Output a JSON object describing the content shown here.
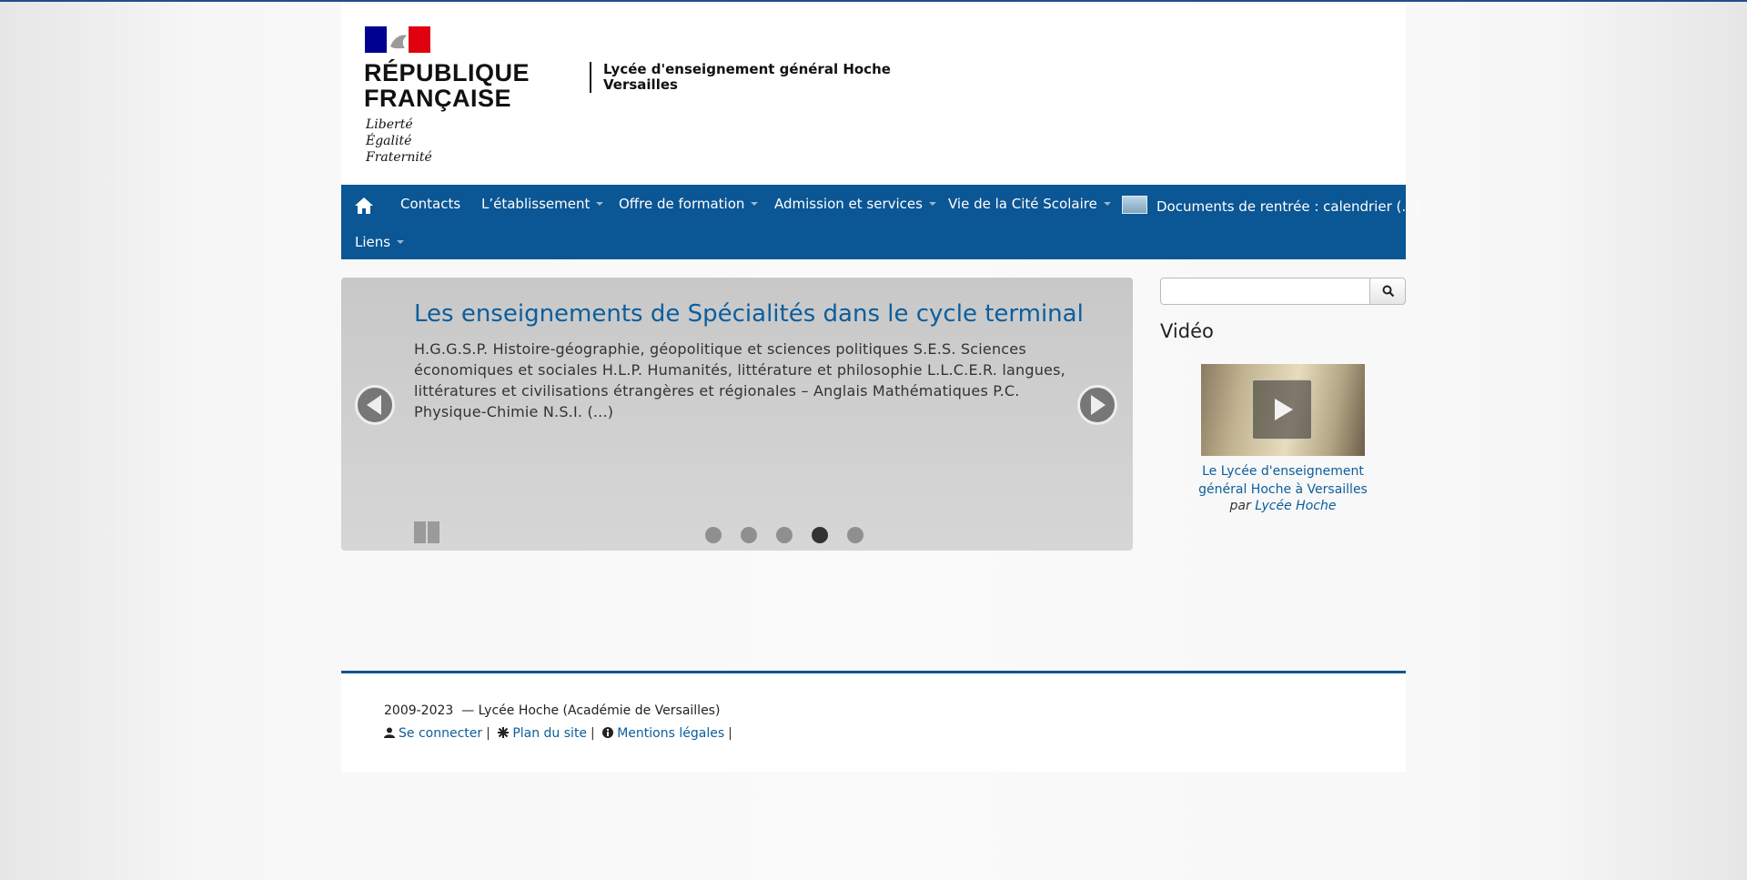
{
  "header": {
    "republic_title_line1": "RÉPUBLIQUE",
    "republic_title_line2": "FRANÇAISE",
    "motto_line1": "Liberté",
    "motto_line2": "Égalité",
    "motto_line3": "Fraternité",
    "school_line1": "Lycée d'enseignement général Hoche",
    "school_line2": "Versailles"
  },
  "nav": {
    "items": [
      {
        "label": "Contacts"
      },
      {
        "label": "L’établissement"
      },
      {
        "label": "Offre de formation"
      },
      {
        "label": "Admission et services"
      },
      {
        "label": "Vie de la Cité Scolaire"
      },
      {
        "label": "Documents de rentrée : calendrier (...)"
      },
      {
        "label": "Liens"
      }
    ],
    "home_icon": "home-icon"
  },
  "slider": {
    "title": "Les enseignements de Spécialités dans le cycle terminal",
    "text": "H.G.G.S.P. Histoire-géographie, géopolitique et sciences politiques S.E.S. Sciences économiques et sociales H.L.P. Humanités, littérature et philosophie L.L.C.E.R. langues, littératures et civilisations étrangères et régionales – Anglais Mathématiques P.C. Physique-Chimie N.S.I. (...)",
    "dots_count": 5,
    "active_dot": 4
  },
  "sidebar": {
    "search_value": "",
    "widget_title": "Vidéo",
    "video_caption_line1": "Le Lycée d'enseignement",
    "video_caption_line2": "général Hoche à Versailles",
    "video_by_prefix": "par",
    "video_by_author": "Lycée Hoche"
  },
  "footer": {
    "copyright": "2009-2023  — Lycée Hoche (Académie de Versailles)",
    "login": "Se connecter",
    "sitemap": "Plan du site",
    "legal": "Mentions légales",
    "separator": "|"
  },
  "colors": {
    "nav_bg": "#0b5694",
    "link": "#0b5e9c",
    "marianne_blue": "#000091",
    "marianne_red": "#e1000f"
  }
}
